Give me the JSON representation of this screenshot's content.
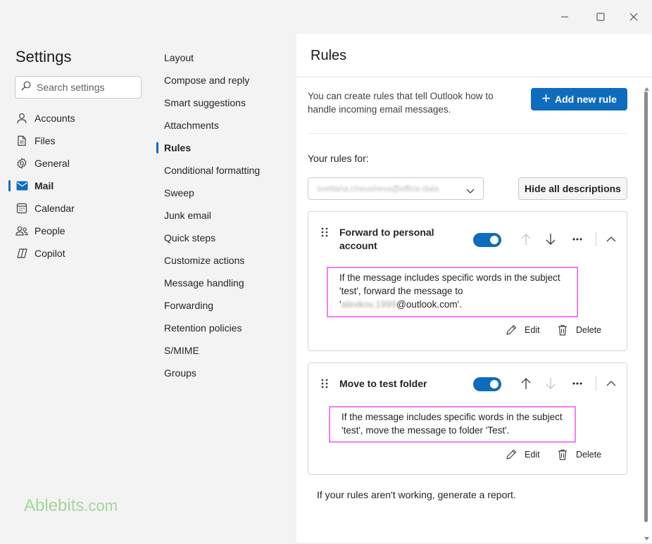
{
  "window": {
    "minimize_icon": "minimize-icon",
    "maximize_icon": "maximize-icon",
    "close_icon": "close-icon"
  },
  "sidebar": {
    "title": "Settings",
    "search_placeholder": "Search settings",
    "items": [
      {
        "label": "Accounts",
        "icon": "person-icon"
      },
      {
        "label": "Files",
        "icon": "document-icon"
      },
      {
        "label": "General",
        "icon": "gear-icon"
      },
      {
        "label": "Mail",
        "icon": "mail-icon",
        "active": true
      },
      {
        "label": "Calendar",
        "icon": "calendar-icon"
      },
      {
        "label": "People",
        "icon": "people-icon"
      },
      {
        "label": "Copilot",
        "icon": "copilot-icon"
      }
    ],
    "watermark": {
      "brand": "Ablebits",
      "domain": ".com"
    }
  },
  "submenu": {
    "items": [
      "Layout",
      "Compose and reply",
      "Smart suggestions",
      "Attachments",
      "Rules",
      "Conditional formatting",
      "Sweep",
      "Junk email",
      "Quick steps",
      "Customize actions",
      "Message handling",
      "Forwarding",
      "Retention policies",
      "S/MIME",
      "Groups"
    ],
    "active": "Rules"
  },
  "main": {
    "title": "Rules",
    "intro": "You can create rules that tell Outlook how to handle incoming email messages.",
    "add_button": "Add new rule",
    "rules_for_label": "Your rules for:",
    "account": "svetlana.cheusheva@office.data",
    "hide_button": "Hide all descriptions",
    "rules": [
      {
        "name": "Forward to personal account",
        "enabled": true,
        "desc_line1": "If the message includes specific words in the subject",
        "desc_line2": "'test', forward the message to",
        "desc_prefix": "'",
        "desc_hidden": "alexkov.1999",
        "desc_suffix": "@outlook.com'.",
        "edit": "Edit",
        "delete": "Delete"
      },
      {
        "name": "Move to test folder",
        "enabled": true,
        "desc_line1": "If the message includes specific words in the subject",
        "desc_line2": "'test', move the message to folder 'Test'.",
        "edit": "Edit",
        "delete": "Delete"
      }
    ],
    "report_text": "If your rules aren't working, generate a report."
  },
  "colors": {
    "accent": "#0f6cbd",
    "highlight_border": "#f17ef1",
    "watermark": "#a6d59c"
  }
}
